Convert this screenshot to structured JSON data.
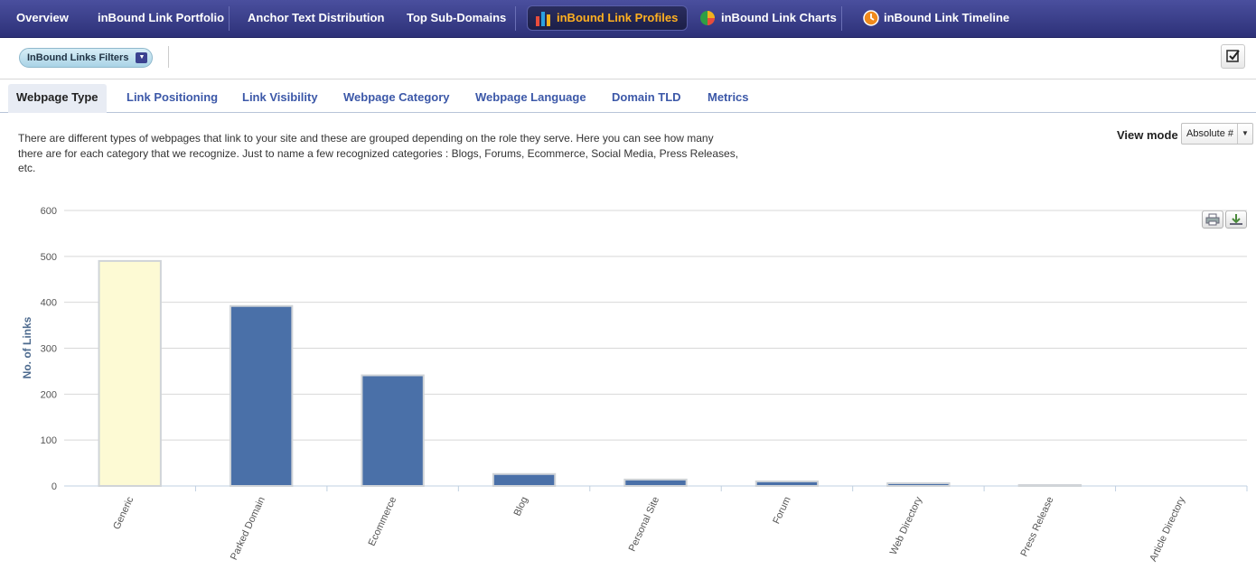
{
  "nav": {
    "items": [
      {
        "label": "Overview"
      },
      {
        "label": "inBound Link Portfolio"
      },
      {
        "label": "Anchor Text Distribution"
      },
      {
        "label": "Top Sub-Domains"
      },
      {
        "label": "inBound Link Profiles"
      },
      {
        "label": "inBound Link Charts"
      },
      {
        "label": "inBound Link Timeline"
      }
    ]
  },
  "filters": {
    "label": "InBound Links Filters"
  },
  "tabs": [
    {
      "label": "Webpage Type"
    },
    {
      "label": "Link Positioning"
    },
    {
      "label": "Link Visibility"
    },
    {
      "label": "Webpage Category"
    },
    {
      "label": "Webpage Language"
    },
    {
      "label": "Domain TLD"
    },
    {
      "label": "Metrics"
    }
  ],
  "description": "There are different types of webpages that link to your site and these are grouped depending on the role they serve. Here you can see how many there are for each category that we recognize. Just to name a few recognized categories : Blogs, Forums, Ecommerce, Social Media, Press Releases, etc.",
  "view_mode": {
    "label": "View mode",
    "value": "Absolute #"
  },
  "colors": {
    "nav_active_text": "#ffb020",
    "bar": "#4a70a8",
    "bar_highlight": "#fdfad4",
    "tab_link": "#3c58a8"
  },
  "chart_data": {
    "type": "bar",
    "categories": [
      "Generic",
      "Parked Domain",
      "Ecommerce",
      "Blog",
      "Personal Site",
      "Forum",
      "Web Directory",
      "Press Release",
      "Article Directory"
    ],
    "values": [
      490,
      392,
      241,
      26,
      14,
      10,
      6,
      2,
      0
    ],
    "ylabel": "No. of Links",
    "ylim": [
      0,
      600
    ],
    "yticks": [
      0,
      100,
      200,
      300,
      400,
      500,
      600
    ],
    "highlighted_category": "Generic",
    "grid": true
  }
}
